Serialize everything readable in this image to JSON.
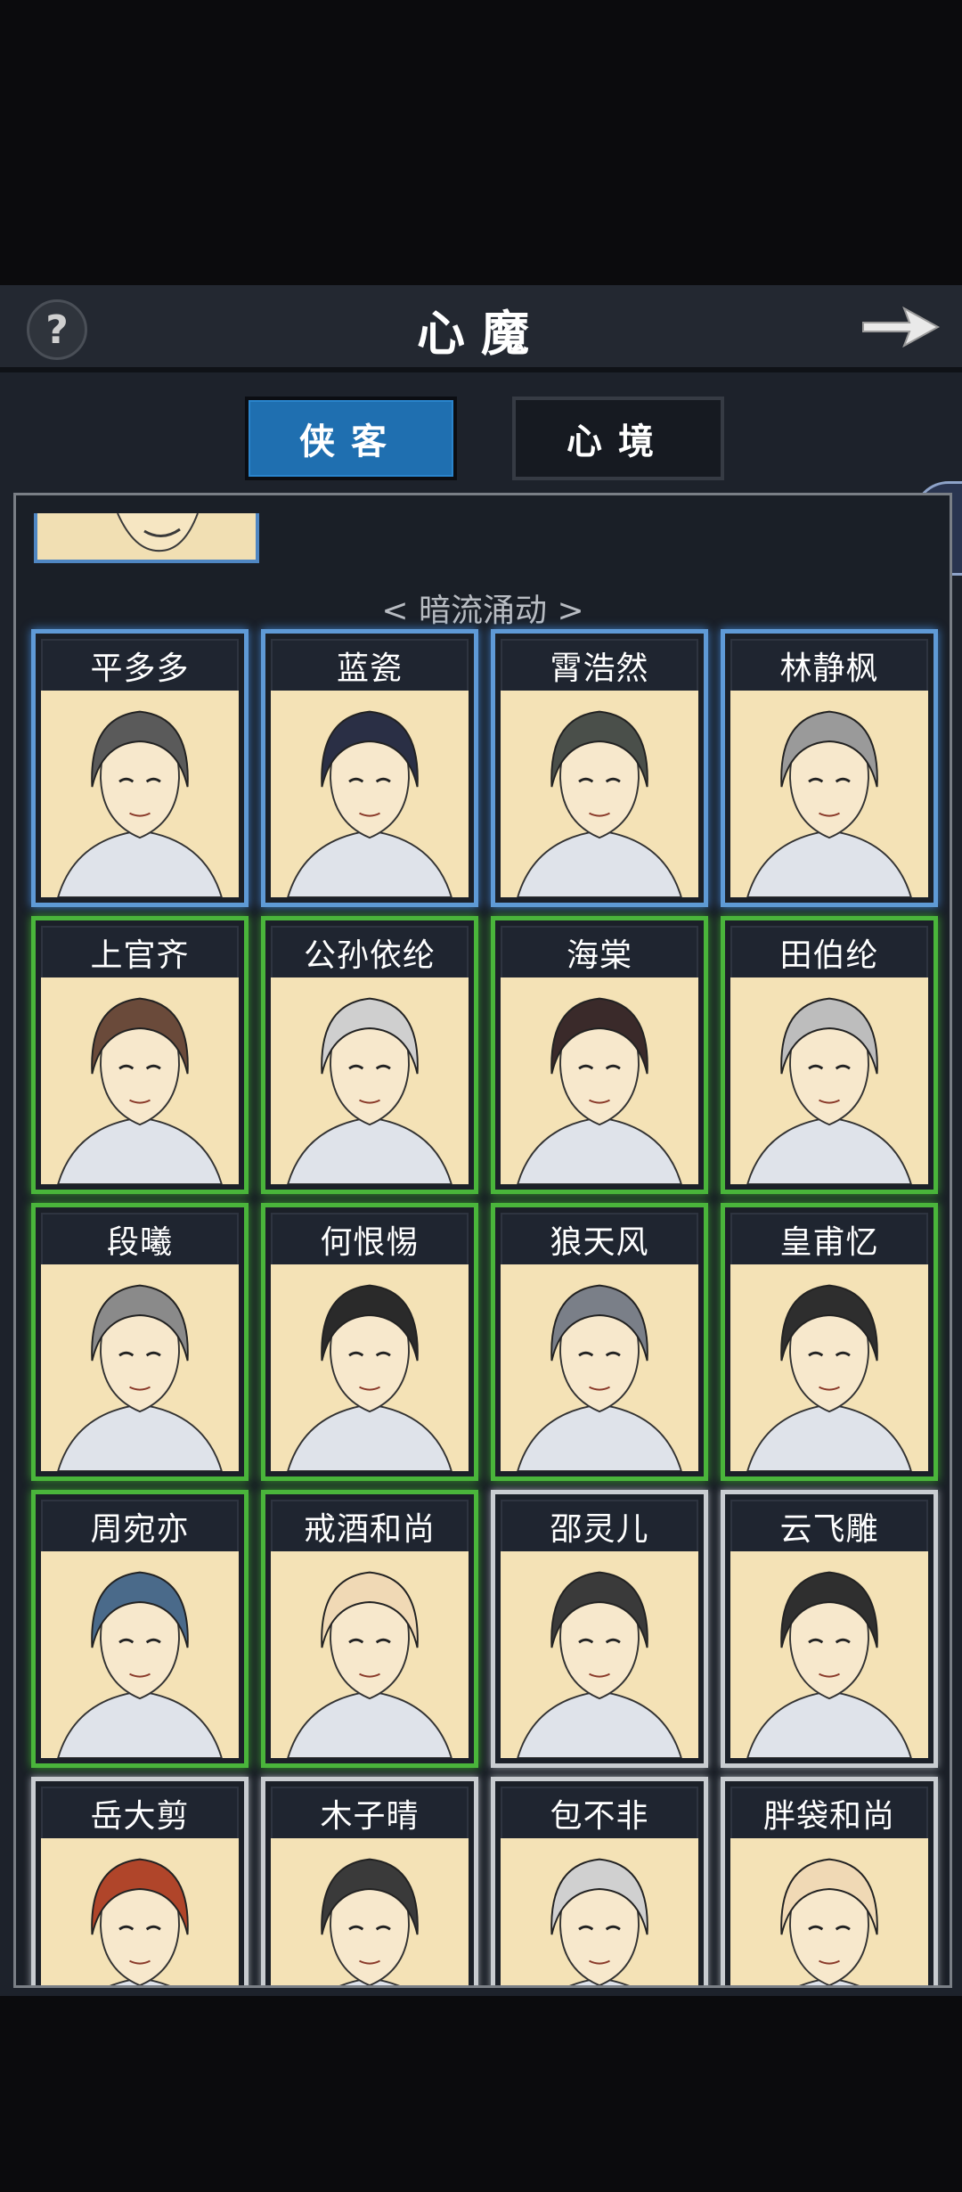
{
  "header": {
    "title": "心魔",
    "help_icon": "question-icon",
    "next_icon": "arrow-right-icon"
  },
  "tabs": [
    {
      "label": "侠客",
      "active": true
    },
    {
      "label": "心境",
      "active": false
    }
  ],
  "section_label": "< 暗流涌动 >",
  "colors": {
    "blue": "#5f9ad6",
    "green": "#4ab53b",
    "white": "#c9cdd1",
    "portrait_bg": "#f4e2b6"
  },
  "characters": [
    {
      "name": "平多多",
      "rarity": "blue"
    },
    {
      "name": "蓝瓷",
      "rarity": "blue"
    },
    {
      "name": "霄浩然",
      "rarity": "blue"
    },
    {
      "name": "林静枫",
      "rarity": "blue"
    },
    {
      "name": "上官齐",
      "rarity": "green"
    },
    {
      "name": "公孙依纶",
      "rarity": "green"
    },
    {
      "name": "海棠",
      "rarity": "green"
    },
    {
      "name": "田伯纶",
      "rarity": "green"
    },
    {
      "name": "段曦",
      "rarity": "green"
    },
    {
      "name": "何恨惕",
      "rarity": "green"
    },
    {
      "name": "狼天风",
      "rarity": "green"
    },
    {
      "name": "皇甫忆",
      "rarity": "green"
    },
    {
      "name": "周宛亦",
      "rarity": "green"
    },
    {
      "name": "戒酒和尚",
      "rarity": "green"
    },
    {
      "name": "邵灵儿",
      "rarity": "white"
    },
    {
      "name": "云飞雕",
      "rarity": "white"
    },
    {
      "name": "岳大剪",
      "rarity": "white"
    },
    {
      "name": "木子晴",
      "rarity": "white"
    },
    {
      "name": "包不非",
      "rarity": "white"
    },
    {
      "name": "胖袋和尚",
      "rarity": "white"
    }
  ]
}
